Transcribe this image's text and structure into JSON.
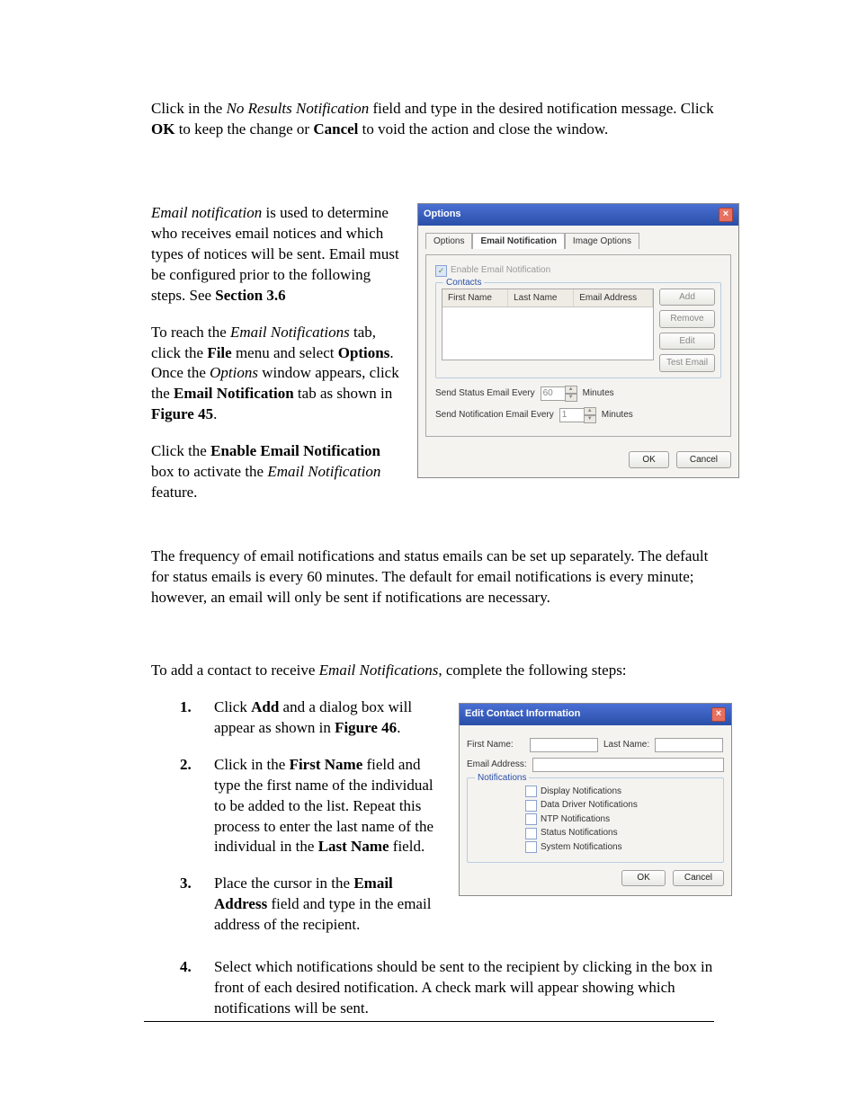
{
  "para1_a": "Click in the ",
  "para1_b": "No Results Notification",
  "para1_c": " field and type in the desired notification message. Click ",
  "para1_d": "OK",
  "para1_e": " to keep the change or ",
  "para1_f": "Cancel",
  "para1_g": " to void the action and close the window.",
  "para2_a": "Email notification",
  "para2_b": " is used to determine who receives email notices and which types of notices will be sent. Email must be configured prior to the following steps. See ",
  "para2_c": "Section 3.6",
  "para3_a": "To reach the ",
  "para3_b": "Email Notifications",
  "para3_c": " tab, click the ",
  "para3_d": "File",
  "para3_e": " menu and select ",
  "para3_f": "Options",
  "para3_g": ". Once the ",
  "para3_h": "Options",
  "para3_i": " window appears, click the ",
  "para3_j": "Email Notification",
  "para3_k": " tab as shown in ",
  "para3_l": "Figure 45",
  "para3_m": ".",
  "para4_a": "Click the ",
  "para4_b": "Enable Email Notification",
  "para4_c": " box to activate the ",
  "para4_d": "Email Notification",
  "para4_e": " feature.",
  "para5": "The frequency of email notifications and status emails can be set up separately. The default for status emails is every 60 minutes. The default for email notifications is every minute; however, an email will only be sent if notifications are necessary.",
  "para6_a": "To add a contact to receive ",
  "para6_b": "Email Notifications",
  "para6_c": ", complete the following steps:",
  "steps": {
    "s1_a": "Click ",
    "s1_b": "Add",
    "s1_c": " and a dialog box will appear as shown in ",
    "s1_d": "Figure 46",
    "s1_e": ".",
    "s2_a": "Click in the ",
    "s2_b": "First Name",
    "s2_c": " field and type the first name of the individual to be added to the list. Repeat this process to enter the last name of the individual in the ",
    "s2_d": "Last Name",
    "s2_e": " field.",
    "s3_a": "Place the cursor in the ",
    "s3_b": "Email Address",
    "s3_c": " field and type in the email address of the recipient.",
    "s4": "Select which notifications should be sent to the recipient by clicking in the box in front of each desired notification. A check mark will appear showing which notifications will be sent."
  },
  "options_dialog": {
    "title": "Options",
    "tabs": {
      "options": "Options",
      "email": "Email Notification",
      "image": "Image Options"
    },
    "enable_label": "Enable Email Notification",
    "contacts_legend": "Contacts",
    "columns": {
      "first": "First Name",
      "last": "Last Name",
      "email": "Email Address"
    },
    "buttons": {
      "add": "Add",
      "remove": "Remove",
      "edit": "Edit",
      "test": "Test Email"
    },
    "status_label": "Send Status Email Every",
    "status_value": "60",
    "notif_label": "Send Notification Email Every",
    "notif_value": "1",
    "minutes": "Minutes",
    "ok": "OK",
    "cancel": "Cancel"
  },
  "edit_dialog": {
    "title": "Edit Contact Information",
    "first_name": "First Name:",
    "last_name": "Last Name:",
    "email": "Email Address:",
    "legend": "Notifications",
    "items": {
      "display": "Display Notifications",
      "ddn": "Data Driver Notifications",
      "ntp": "NTP Notifications",
      "status": "Status Notifications",
      "system": "System Notifications"
    },
    "ok": "OK",
    "cancel": "Cancel"
  }
}
